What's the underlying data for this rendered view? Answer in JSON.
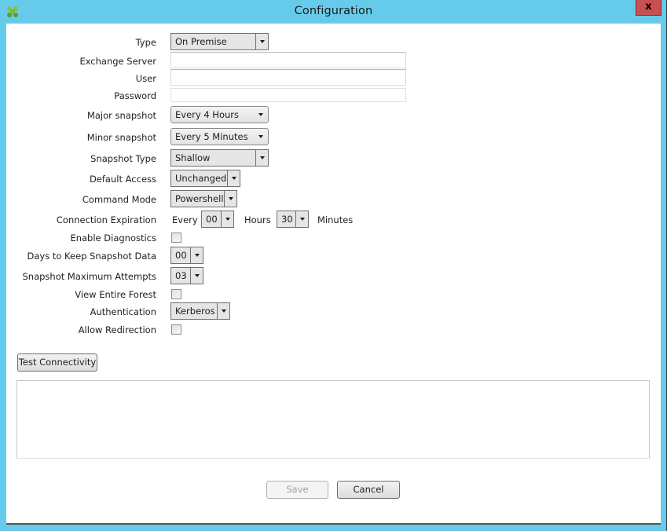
{
  "window": {
    "title": "Configuration",
    "app_icon": "citrix-clover-icon",
    "close_label": "x"
  },
  "form": {
    "type": {
      "label": "Type",
      "value": "On Premise"
    },
    "exchange_server": {
      "label": "Exchange Server",
      "value": ""
    },
    "user": {
      "label": "User",
      "value": ""
    },
    "password": {
      "label": "Password",
      "value": ""
    },
    "major_snapshot": {
      "label": "Major snapshot",
      "value": "Every 4 Hours"
    },
    "minor_snapshot": {
      "label": "Minor snapshot",
      "value": "Every 5 Minutes"
    },
    "snapshot_type": {
      "label": "Snapshot Type",
      "value": "Shallow"
    },
    "default_access": {
      "label": "Default Access",
      "value": "Unchanged"
    },
    "command_mode": {
      "label": "Command Mode",
      "value": "Powershell"
    },
    "connection_expiration": {
      "label": "Connection Expiration",
      "every_label": "Every",
      "hours_value": "00",
      "hours_label": "Hours",
      "minutes_value": "30",
      "minutes_label": "Minutes"
    },
    "enable_diagnostics": {
      "label": "Enable Diagnostics",
      "checked": false
    },
    "days_to_keep": {
      "label": "Days to Keep Snapshot Data",
      "value": "00"
    },
    "max_attempts": {
      "label": "Snapshot Maximum Attempts",
      "value": "03"
    },
    "view_entire_forest": {
      "label": "View Entire Forest",
      "checked": false
    },
    "authentication": {
      "label": "Authentication",
      "value": "Kerberos"
    },
    "allow_redirection": {
      "label": "Allow Redirection",
      "checked": false
    }
  },
  "actions": {
    "test_connectivity": "Test Connectivity",
    "save": "Save",
    "cancel": "Cancel"
  },
  "output": {
    "text": ""
  }
}
